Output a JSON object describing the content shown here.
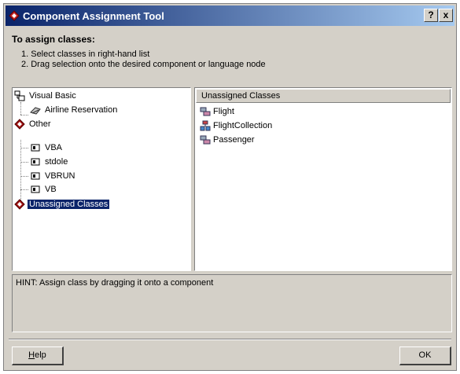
{
  "window": {
    "title": "Component Assignment Tool",
    "help_button": "?",
    "close_button": "x"
  },
  "instructions": {
    "heading": "To assign classes:",
    "steps": [
      "1. Select classes in right-hand list",
      "2. Drag selection onto the desired component or language node"
    ]
  },
  "tree": {
    "items": [
      {
        "label": "Visual Basic",
        "icon": "vb-project-icon"
      },
      {
        "label": "Airline Reservation",
        "icon": "component-icon"
      },
      {
        "label": "Other",
        "icon": "diamond-node-icon"
      },
      {
        "label": "VBA",
        "icon": "library-icon"
      },
      {
        "label": "stdole",
        "icon": "library-icon"
      },
      {
        "label": "VBRUN",
        "icon": "library-icon"
      },
      {
        "label": "VB",
        "icon": "library-icon"
      },
      {
        "label": "Unassigned Classes",
        "icon": "diamond-node-icon",
        "selected": true
      }
    ]
  },
  "class_list": {
    "header": "Unassigned Classes",
    "items": [
      {
        "label": "Flight",
        "icon": "class-icon"
      },
      {
        "label": "FlightCollection",
        "icon": "collection-class-icon"
      },
      {
        "label": "Passenger",
        "icon": "class-icon"
      }
    ]
  },
  "hint": "HINT: Assign class by dragging it onto a component",
  "buttons": {
    "help_first": "H",
    "help_rest": "elp",
    "ok": "OK"
  },
  "colors": {
    "title_gradient_start": "#0a246a",
    "title_gradient_end": "#a6caf0",
    "selection": "#0a246a",
    "face": "#d4d0c8"
  }
}
